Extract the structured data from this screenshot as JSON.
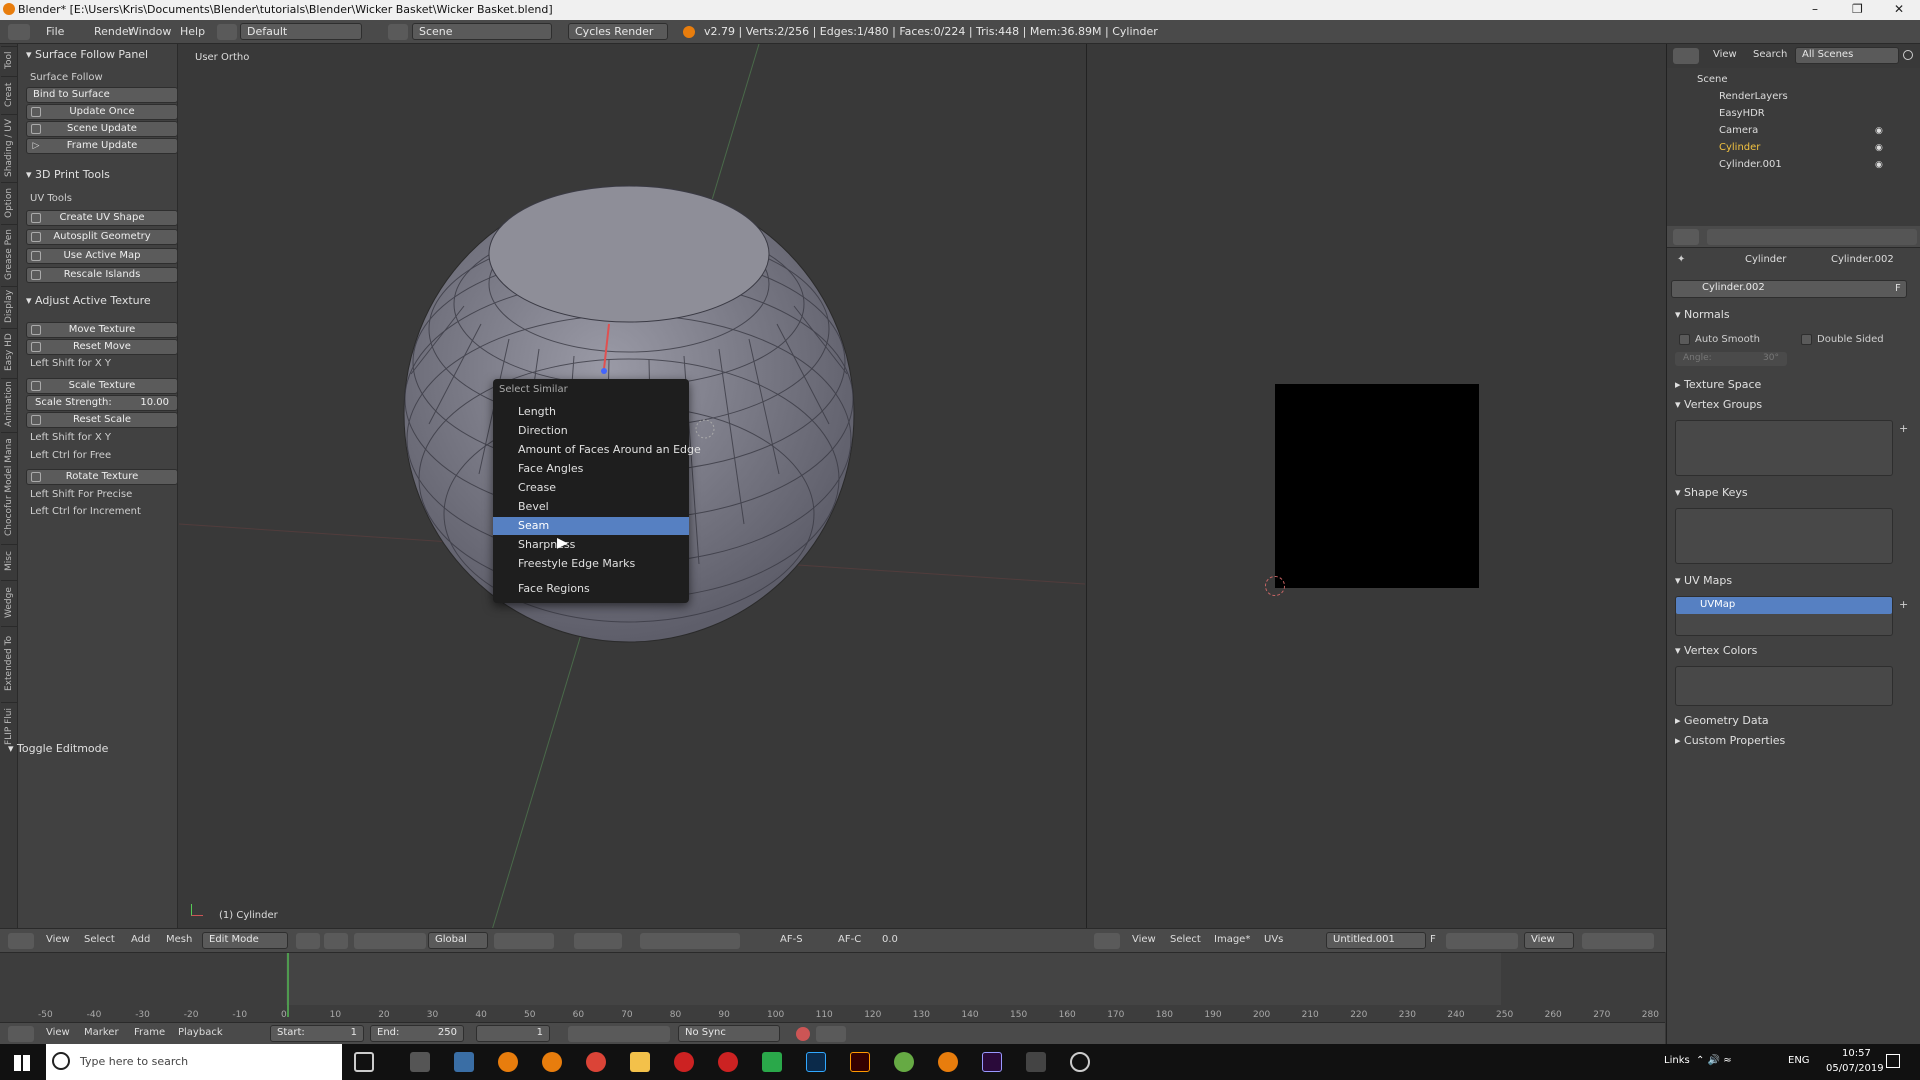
{
  "window": {
    "title": "Blender* [E:\\Users\\Kris\\Documents\\Blender\\tutorials\\Blender\\Wicker Basket\\Wicker Basket.blend]"
  },
  "infobar": {
    "menus": [
      "File",
      "Render",
      "Window",
      "Help"
    ],
    "layout": "Default",
    "scene": "Scene",
    "engine": "Cycles Render",
    "stats": "v2.79 | Verts:2/256 | Edges:1/480 | Faces:0/224 | Tris:448 | Mem:36.89M | Cylinder"
  },
  "left_tabs": [
    "Tool",
    "Creat",
    "Shading / UV",
    "Option",
    "Grease Pen",
    "Display",
    "Easy HD",
    "Animation",
    "Chocofur Model Mana",
    "Misc",
    "Wedge",
    "Extended To",
    "FLIP Flui"
  ],
  "toolshelf": {
    "surface_follow": {
      "header": "Surface Follow Panel",
      "label": "Surface Follow",
      "bind": "Bind to Surface",
      "update_once": "Update Once",
      "scene_update": "Scene Update",
      "frame_update": "Frame Update"
    },
    "print_tools": {
      "header": "3D Print Tools",
      "label": "UV Tools",
      "create_uv": "Create UV Shape",
      "autosplit": "Autosplit Geometry",
      "use_active": "Use Active Map",
      "rescale": "Rescale Islands"
    },
    "adjust_texture": {
      "header": "Adjust Active Texture",
      "move": "Move Texture",
      "reset_move": "Reset Move",
      "hint1": "Left Shift for X Y",
      "scale": "Scale Texture",
      "strength_label": "Scale Strength:",
      "strength_value": "10.00",
      "reset_scale": "Reset Scale",
      "hint2": "Left Shift for X Y",
      "hint3": "Left Ctrl for Free",
      "rotate": "Rotate Texture",
      "hint4": "Left Shift For Precise",
      "hint5": "Left Ctrl for Increment"
    },
    "toggle_editmode": "Toggle Editmode"
  },
  "viewport": {
    "view_label": "User Ortho",
    "object_label": "(1) Cylinder"
  },
  "select_similar": {
    "title": "Select Similar",
    "items": [
      "Length",
      "Direction",
      "Amount of Faces Around an Edge",
      "Face Angles",
      "Crease",
      "Bevel",
      "Seam",
      "Sharpness",
      "Freestyle Edge Marks",
      "Face Regions"
    ],
    "selected": "Seam"
  },
  "view3d_header": {
    "menus": [
      "View",
      "Select",
      "Add",
      "Mesh"
    ],
    "mode": "Edit Mode",
    "orientation": "Global",
    "afs": "AF-S",
    "afc": "AF-C",
    "value": "0.0"
  },
  "uv_header": {
    "menus": [
      "View",
      "Select",
      "Image*",
      "UVs"
    ],
    "image": "Untitled.001",
    "f": "F",
    "view": "View"
  },
  "timeline": {
    "ticks": [
      "-50",
      "-40",
      "-30",
      "-20",
      "-10",
      "0",
      "10",
      "20",
      "30",
      "40",
      "50",
      "60",
      "70",
      "80",
      "90",
      "100",
      "110",
      "120",
      "130",
      "140",
      "150",
      "160",
      "170",
      "180",
      "190",
      "200",
      "210",
      "220",
      "230",
      "240",
      "250",
      "260",
      "270",
      "280"
    ],
    "menus": [
      "View",
      "Marker",
      "Frame",
      "Playback"
    ],
    "start_label": "Start:",
    "start": "1",
    "end_label": "End:",
    "end": "250",
    "current": "1",
    "sync": "No Sync"
  },
  "outliner": {
    "menus": [
      "View",
      "Search"
    ],
    "filter": "All Scenes",
    "rows": [
      "Scene",
      "RenderLayers",
      "EasyHDR",
      "Camera",
      "Cylinder",
      "Cylinder.001"
    ]
  },
  "properties": {
    "breadcrumb_obj": "Cylinder",
    "breadcrumb_mesh": "Cylinder.002",
    "mesh_name": "Cylinder.002",
    "fake": "F",
    "normals": "Normals",
    "auto_smooth": "Auto Smooth",
    "double_sided": "Double Sided",
    "angle": "Angle:",
    "angle_value": "30°",
    "texture_space": "Texture Space",
    "vertex_groups": "Vertex Groups",
    "shape_keys": "Shape Keys",
    "uv_maps": "UV Maps",
    "uvmap": "UVMap",
    "vertex_colors": "Vertex Colors",
    "geometry_data": "Geometry Data",
    "custom_properties": "Custom Properties"
  },
  "taskbar": {
    "search_placeholder": "Type here to search",
    "links": "Links",
    "lang": "ENG",
    "time": "10:57",
    "date": "05/07/2019"
  },
  "colors": {
    "accent": "#5680c2",
    "panel": "#414141",
    "viewport": "#393939"
  }
}
